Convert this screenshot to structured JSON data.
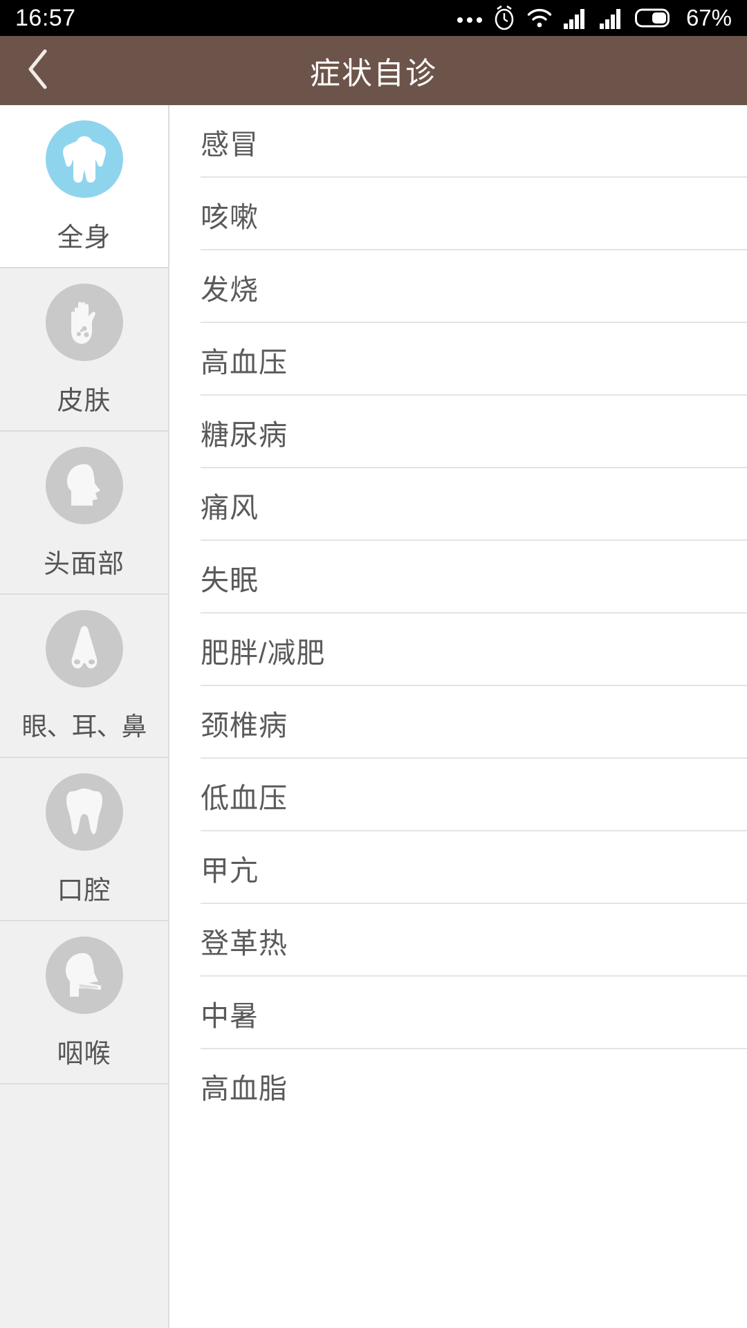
{
  "status_bar": {
    "time": "16:57",
    "battery_text": "67%",
    "icons": [
      "more-dots-icon",
      "alarm-clock-icon",
      "wifi-icon",
      "signal-bars-icon",
      "signal-bars-icon",
      "battery-icon"
    ],
    "background": "#000000",
    "foreground": "#ffffff"
  },
  "header": {
    "title": "症状自诊",
    "back_icon": "chevron-left-icon",
    "background": "#6d544a",
    "text_color": "#ffffff"
  },
  "sidebar": {
    "selected_index": 0,
    "selected_accent": "#8fd4ed",
    "idle_accent": "#c9c9c9",
    "items": [
      {
        "label": "全身",
        "icon": "torso-body-icon",
        "selected": true
      },
      {
        "label": "皮肤",
        "icon": "hand-rash-icon",
        "selected": false
      },
      {
        "label": "头面部",
        "icon": "head-profile-icon",
        "selected": false
      },
      {
        "label": "眼、耳、鼻",
        "icon": "nose-icon",
        "selected": false
      },
      {
        "label": "口腔",
        "icon": "tooth-icon",
        "selected": false
      },
      {
        "label": "咽喉",
        "icon": "throat-head-icon",
        "selected": false
      }
    ]
  },
  "symptom_list": {
    "items": [
      {
        "label": "感冒"
      },
      {
        "label": "咳嗽"
      },
      {
        "label": "发烧"
      },
      {
        "label": "高血压"
      },
      {
        "label": "糖尿病"
      },
      {
        "label": "痛风"
      },
      {
        "label": "失眠"
      },
      {
        "label": "肥胖/减肥"
      },
      {
        "label": "颈椎病"
      },
      {
        "label": "低血压"
      },
      {
        "label": "甲亢"
      },
      {
        "label": "登革热"
      },
      {
        "label": "中暑"
      },
      {
        "label": "高血脂"
      }
    ],
    "text_color": "#5a5a5a",
    "divider_color": "#e4e4e4"
  }
}
